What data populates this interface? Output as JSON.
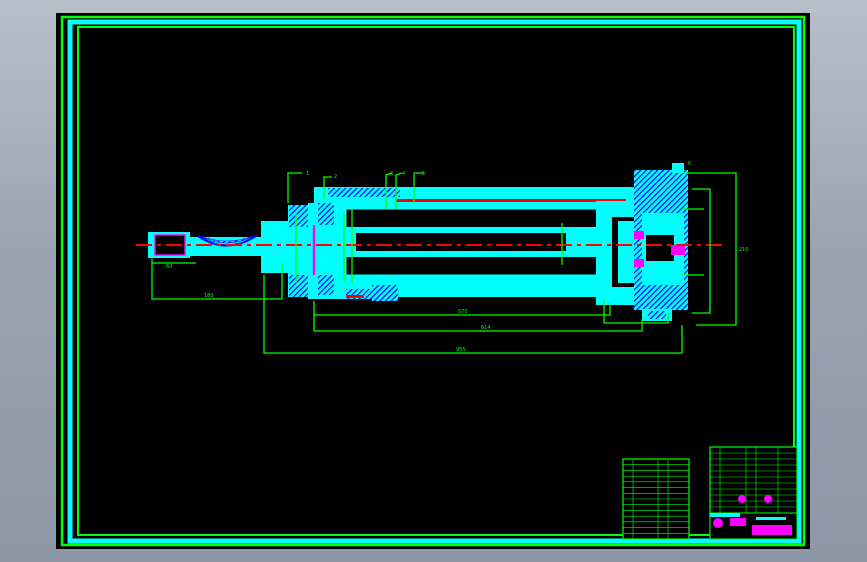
{
  "colors": {
    "background": "#000000",
    "frame_outer": "#00ff00",
    "frame_inner": "#00ffff",
    "body": "#00ffff",
    "hatch": "#0000ff",
    "centerline": "#ff0000",
    "dimension": "#00ff00",
    "highlight": "#ff00ff",
    "text": "#00ff00"
  },
  "dimensions": {
    "rod_eye_width": "60",
    "rod_length": "180",
    "piston_stroke": "570",
    "cylinder_length": "614",
    "overall_length": "955",
    "head_height": "210"
  },
  "balloons": [
    "1",
    "2",
    "3",
    "4",
    "5",
    "6"
  ],
  "title_block": {
    "parts_list_rows": [
      "",
      "",
      "",
      "",
      "",
      "",
      "",
      "",
      "",
      "",
      "",
      "",
      "",
      ""
    ],
    "header_rows": [
      "",
      "",
      "",
      "",
      "",
      "",
      "",
      "",
      "",
      "",
      ""
    ]
  }
}
